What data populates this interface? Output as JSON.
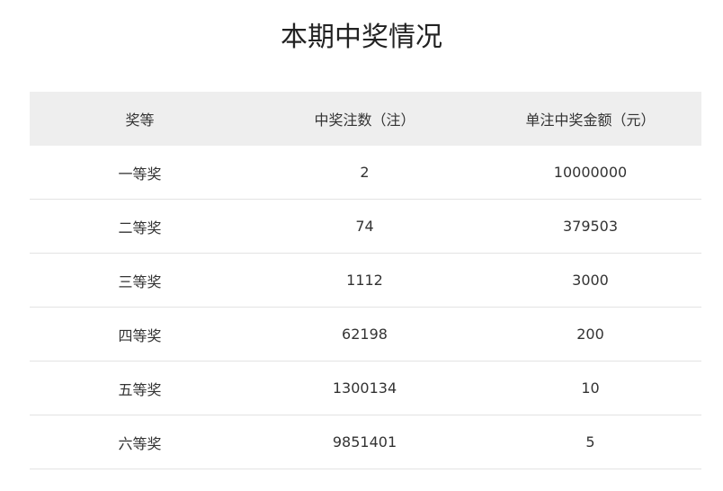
{
  "page": {
    "title": "本期中奖情况"
  },
  "table": {
    "headers": [
      "奖等",
      "中奖注数（注）",
      "单注中奖金额（元）"
    ],
    "rows": [
      [
        "一等奖",
        "2",
        "10000000"
      ],
      [
        "二等奖",
        "74",
        "379503"
      ],
      [
        "三等奖",
        "1112",
        "3000"
      ],
      [
        "四等奖",
        "62198",
        "200"
      ],
      [
        "五等奖",
        "1300134",
        "10"
      ],
      [
        "六等奖",
        "9851401",
        "5"
      ]
    ]
  },
  "colors": {
    "header_bg": "#eeeeee",
    "row_divider": "#e3e3e3",
    "text": "#333333"
  }
}
